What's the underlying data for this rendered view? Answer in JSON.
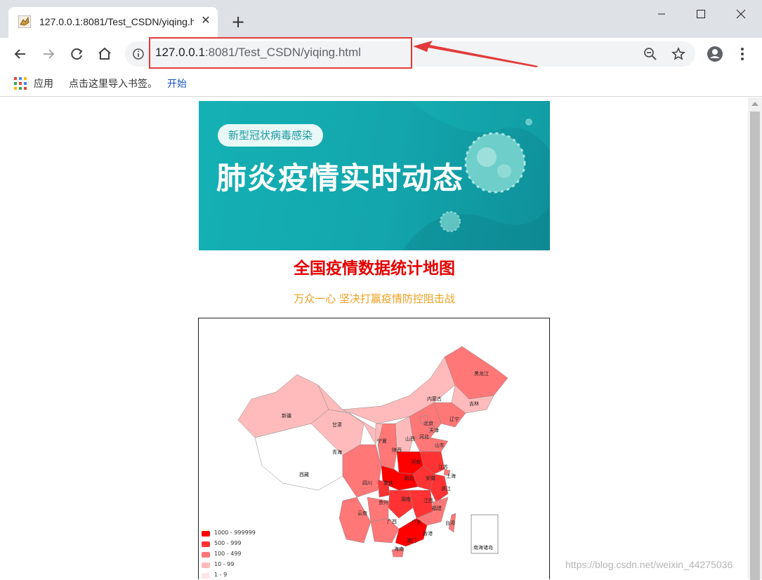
{
  "browser": {
    "tab_title": "127.0.0.1:8081/Test_CSDN/yiqing.html",
    "url_host": "127.0.0.1",
    "url_rest": ":8081/Test_CSDN/yiqing.html",
    "new_tab_glyph": "+",
    "close_glyph": "✕",
    "bookmarks": {
      "apps": "应用",
      "import_hint": "点击这里导入书签。",
      "start_link": "开始"
    }
  },
  "colors": {
    "accent_red": "#e60000",
    "subtitle_orange": "#f0a020",
    "banner_teal": "#14b1b4"
  },
  "page": {
    "banner_pill": "新型冠状病毒感染",
    "banner_title": "肺炎疫情实时动态",
    "title": "全国疫情数据统计地图",
    "subtitle": "万众一心 坚决打赢疫情防控阻击战"
  },
  "map": {
    "legend": [
      {
        "label": "1000 - 999999",
        "color": "#ff0000"
      },
      {
        "label": "500 - 999",
        "color": "#ff3333"
      },
      {
        "label": "100 - 499",
        "color": "#ff7777"
      },
      {
        "label": "10 - 99",
        "color": "#ffbbbb"
      },
      {
        "label": "1 - 9",
        "color": "#ffe6e6"
      }
    ],
    "provinces": [
      "黑龙江",
      "吉林",
      "辽宁",
      "内蒙古",
      "北京",
      "天津",
      "河北",
      "山西",
      "山东",
      "新疆",
      "甘肃",
      "宁夏",
      "陕西",
      "青海",
      "河南",
      "江苏",
      "安徽",
      "上海",
      "湖北",
      "浙江",
      "四川",
      "重庆",
      "西藏",
      "湖南",
      "江西",
      "贵州",
      "福建",
      "云南",
      "广西",
      "广东",
      "台湾",
      "香港",
      "澳门",
      "海南",
      "南海诸岛"
    ]
  },
  "watermark": "https://blog.csdn.net/weixin_44275036"
}
